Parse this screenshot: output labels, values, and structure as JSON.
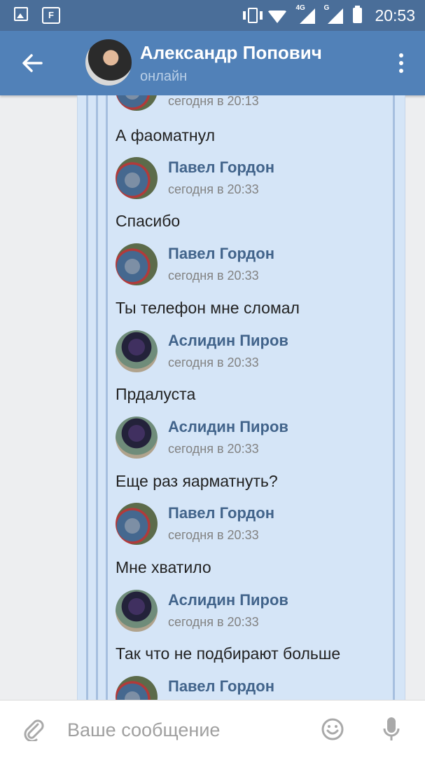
{
  "status_bar": {
    "time": "20:53",
    "network": "4G",
    "network2": "G",
    "icons": [
      "gallery-icon",
      "f-icon",
      "vibrate-icon",
      "wifi-icon",
      "signal-icon",
      "battery-icon"
    ]
  },
  "header": {
    "name": "Александр Попович",
    "status": "онлайн",
    "icons": [
      "back-arrow-icon",
      "more-vertical-icon"
    ]
  },
  "messages": [
    {
      "sender": "",
      "time": "сегодня в 20:13",
      "text": "А фаоматнул",
      "avatar": "pavel"
    },
    {
      "sender": "Павел Гордон",
      "time": "сегодня в 20:33",
      "text": "Спасибо",
      "avatar": "pavel"
    },
    {
      "sender": "Павел Гордон",
      "time": "сегодня в 20:33",
      "text": "Ты телефон мне сломал",
      "avatar": "pavel"
    },
    {
      "sender": "Аслидин Пиров",
      "time": "сегодня в 20:33",
      "text": "Прдалуста",
      "avatar": "aslidin"
    },
    {
      "sender": "Аслидин Пиров",
      "time": "сегодня в 20:33",
      "text": "Еще раз яарматнуть?",
      "avatar": "aslidin"
    },
    {
      "sender": "Павел Гордон",
      "time": "сегодня в 20:33",
      "text": "Мне хватило",
      "avatar": "pavel"
    },
    {
      "sender": "Аслидин Пиров",
      "time": "сегодня в 20:33",
      "text": "Так что не подбирают больше",
      "avatar": "aslidin"
    },
    {
      "sender": "Павел Гордон",
      "time": "",
      "text": "",
      "avatar": "pavel"
    }
  ],
  "input": {
    "placeholder": "Ваше сообщение",
    "value": ""
  },
  "colors": {
    "header": "#5181b8",
    "status_bar": "#4a6e99",
    "forward_bg": "#d5e5f7",
    "name": "#42648b"
  }
}
